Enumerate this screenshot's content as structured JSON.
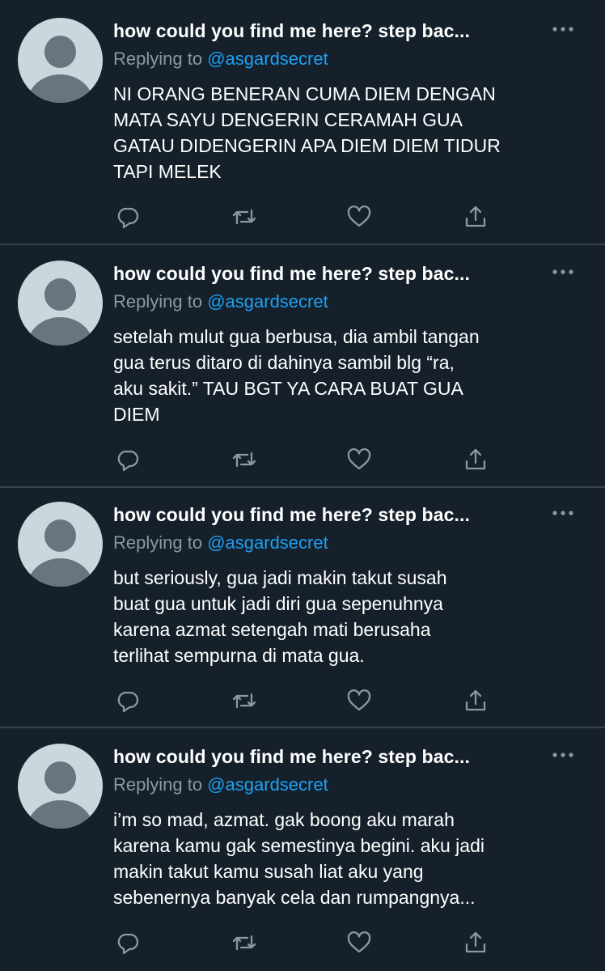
{
  "colors": {
    "background": "#15202b",
    "divider": "#38444d",
    "secondary_text": "#8899a6",
    "link": "#1da1f2",
    "icon": "#8899a6"
  },
  "icons": [
    "more-icon",
    "reply-icon",
    "retweet-icon",
    "like-icon",
    "share-icon"
  ],
  "tweets": [
    {
      "name": "how could you find me here? step bac...",
      "replying_prefix": "Replying to",
      "handle": "@asgardsecret",
      "lines": [
        "NI ORANG BENERAN CUMA DIEM DENGAN",
        "MATA SAYU DENGERIN CERAMAH GUA",
        "GATAU DIDENGERIN APA DIEM DIEM TIDUR",
        "TAPI MELEK"
      ]
    },
    {
      "name": "how could you find me here? step bac...",
      "replying_prefix": "Replying to",
      "handle": "@asgardsecret",
      "lines": [
        "setelah mulut gua berbusa, dia ambil tangan",
        "gua terus ditaro di dahinya sambil blg “ra,",
        "aku sakit.” TAU BGT YA CARA BUAT GUA",
        "DIEM"
      ]
    },
    {
      "name": "how could you find me here? step bac...",
      "replying_prefix": "Replying to",
      "handle": "@asgardsecret",
      "lines": [
        "but seriously, gua jadi makin takut susah",
        "buat gua untuk jadi diri gua sepenuhnya",
        "karena azmat setengah mati berusaha",
        "terlihat sempurna di mata gua."
      ]
    },
    {
      "name": "how could you find me here? step bac...",
      "replying_prefix": "Replying to",
      "handle": "@asgardsecret",
      "lines": [
        "i’m so mad, azmat. gak boong aku marah",
        "karena kamu gak semestinya begini. aku jadi",
        "makin takut kamu susah liat aku yang",
        "sebenernya banyak cela dan rumpangnya..."
      ]
    }
  ]
}
